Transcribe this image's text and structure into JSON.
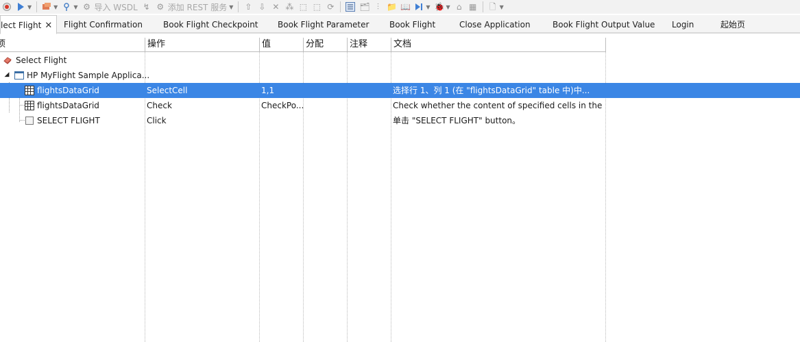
{
  "toolbar": {
    "import_wsdl_label": "导入 WSDL",
    "add_rest_label": "添加 REST 服务"
  },
  "tabs": [
    {
      "label": "lect Flight",
      "active": true
    },
    {
      "label": "Flight Confirmation"
    },
    {
      "label": "Book Flight Checkpoint"
    },
    {
      "label": "Book Flight Parameter"
    },
    {
      "label": "Book Flight"
    },
    {
      "label": "Close Application"
    },
    {
      "label": "Book Flight Output Value"
    },
    {
      "label": "Login"
    },
    {
      "label": "起始页"
    }
  ],
  "grid": {
    "columns": [
      {
        "label": "项"
      },
      {
        "label": "操作"
      },
      {
        "label": "值"
      },
      {
        "label": "分配"
      },
      {
        "label": "注释"
      },
      {
        "label": "文档"
      }
    ],
    "rows": [
      {
        "item": "Select Flight",
        "icon": "action-icon",
        "operation": "",
        "value": "",
        "assign": "",
        "comment": "",
        "doc": ""
      },
      {
        "item": "HP MyFlight Sample Applica...",
        "icon": "window-icon",
        "operation": "",
        "value": "",
        "assign": "",
        "comment": "",
        "doc": ""
      },
      {
        "item": "flightsDataGrid",
        "icon": "table-icon",
        "operation": "SelectCell",
        "value": "1,1",
        "assign": "",
        "comment": "",
        "doc": "选择行 1、列 1 (在 \"flightsDataGrid\" table 中)中..."
      },
      {
        "item": "flightsDataGrid",
        "icon": "table-icon",
        "operation": "Check",
        "value": "CheckPo...",
        "assign": "",
        "comment": "",
        "doc": "Check whether the content of specified cells in the \"..."
      },
      {
        "item": "SELECT FLIGHT",
        "icon": "button-icon",
        "operation": "Click",
        "value": "",
        "assign": "",
        "comment": "",
        "doc": "单击 \"SELECT FLIGHT\" button。"
      }
    ],
    "selected_row_index": 2
  },
  "colors": {
    "selection": "#3b86e5",
    "tab_bar": "#f4f4f4"
  }
}
